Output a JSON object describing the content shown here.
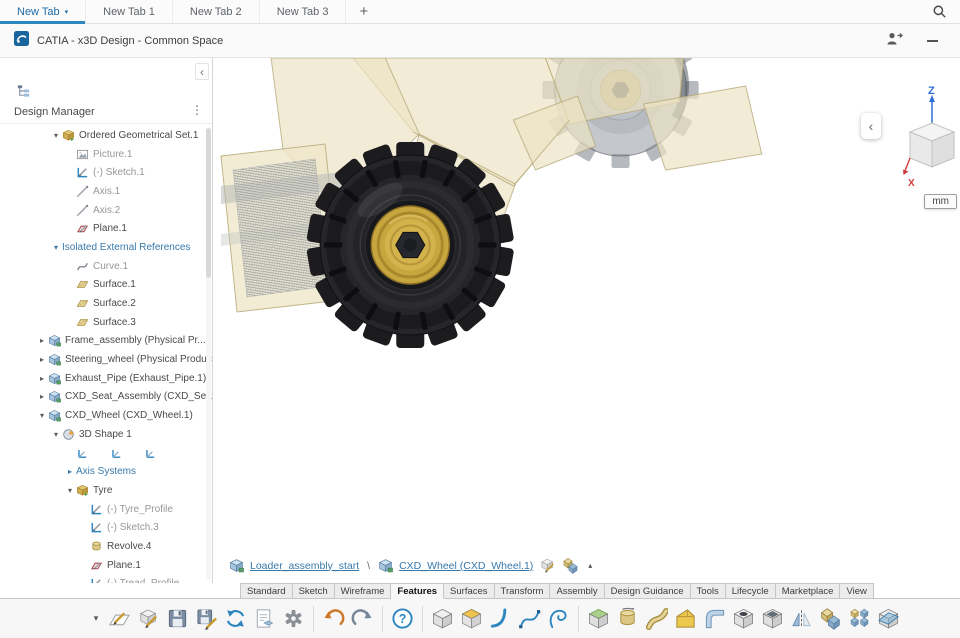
{
  "colors": {
    "accent": "#2e86c1",
    "link": "#3879ab",
    "hub_gold": "#c7a63f"
  },
  "icons": {
    "collapse_chevron": "‹",
    "kebab": "⋮",
    "caret_up": "▴",
    "overflow_chevron": "▾",
    "tab_caret": "▾",
    "expander_open": "▾",
    "expander_closed": "▸",
    "tab_search": "magnifier-icon",
    "share": "share-user-icon",
    "minimize": "minimize-icon"
  },
  "browser_tabs": {
    "items": [
      {
        "label": "New Tab",
        "active": true
      },
      {
        "label": "New Tab 1",
        "active": false
      },
      {
        "label": "New Tab 2",
        "active": false
      },
      {
        "label": "New Tab 3",
        "active": false
      }
    ],
    "new_tab_label": "+"
  },
  "title_bar": {
    "title": "CATIA - x3D Design - Common Space"
  },
  "design_manager": {
    "header": "Design Manager",
    "tree": [
      {
        "label": "Ordered Geometrical Set.1",
        "depth": 1,
        "exp": "open",
        "icon": "geoset"
      },
      {
        "label": "Picture.1",
        "depth": 2,
        "icon": "picture",
        "dim": true
      },
      {
        "label": "(-) Sketch.1",
        "depth": 2,
        "icon": "sketch",
        "dim": true
      },
      {
        "label": "Axis.1",
        "depth": 2,
        "icon": "axis",
        "dim": true
      },
      {
        "label": "Axis.2",
        "depth": 2,
        "icon": "axis",
        "dim": true
      },
      {
        "label": "Plane.1",
        "depth": 2,
        "icon": "plane"
      },
      {
        "label": "Isolated External References",
        "depth": 1,
        "exp": "open",
        "blue": true
      },
      {
        "label": "Curve.1",
        "depth": 2,
        "icon": "curve",
        "dim": true
      },
      {
        "label": "Surface.1",
        "depth": 2,
        "icon": "surface"
      },
      {
        "label": "Surface.2",
        "depth": 2,
        "icon": "surface"
      },
      {
        "label": "Surface.3",
        "depth": 2,
        "icon": "surface"
      },
      {
        "label": "Frame_assembly (Physical Pr...",
        "depth": 0,
        "exp": "closed",
        "icon": "product"
      },
      {
        "label": "Steering_wheel (Physical Product...",
        "depth": 0,
        "exp": "closed",
        "icon": "product"
      },
      {
        "label": "Exhaust_Pipe (Exhaust_Pipe.1)",
        "depth": 0,
        "exp": "closed",
        "icon": "product"
      },
      {
        "label": "CXD_Seat_Assembly (CXD_Seat...",
        "depth": 0,
        "exp": "closed",
        "icon": "product"
      },
      {
        "label": "CXD_Wheel (CXD_Wheel.1)",
        "depth": 0,
        "exp": "open",
        "icon": "product"
      },
      {
        "label": "3D Shape 1",
        "depth": 1,
        "exp": "open",
        "icon": "shape3d"
      },
      {
        "icons": [
          "axsys",
          "axsys",
          "axsys"
        ],
        "depth": 2
      },
      {
        "label": "Axis Systems",
        "depth": 2,
        "exp": "closed",
        "blue": true
      },
      {
        "label": "Tyre",
        "depth": 2,
        "exp": "open",
        "icon": "geoset"
      },
      {
        "label": "(-) Tyre_Profile",
        "depth": 3,
        "icon": "sketch",
        "dim": true
      },
      {
        "label": "(-) Sketch.3",
        "depth": 3,
        "icon": "sketch",
        "dim": true
      },
      {
        "label": "Revolve.4",
        "depth": 3,
        "icon": "revolve"
      },
      {
        "label": "Plane.1",
        "depth": 3,
        "icon": "plane"
      },
      {
        "label": "(-) Tread_Profile",
        "depth": 3,
        "icon": "sketch",
        "dim": true
      }
    ]
  },
  "viewport": {
    "unit": "mm",
    "axes": {
      "z": "Z",
      "x": "X"
    },
    "breadcrumb": {
      "root": "Loader_assembly_start",
      "separator": "\\",
      "current": "CXD_Wheel (CXD_Wheel.1)"
    }
  },
  "ribbon": {
    "tabs": [
      "Standard",
      "Sketch",
      "Wireframe",
      "Features",
      "Surfaces",
      "Transform",
      "Assembly",
      "Design Guidance",
      "Tools",
      "Lifecycle",
      "Marketplace",
      "View"
    ],
    "active": "Features"
  },
  "toolbar": {
    "items": [
      "sketch",
      "positioned-sketch",
      "save",
      "save-with-options",
      "update",
      "drawing",
      "settings",
      "|",
      "undo",
      "redo",
      "|",
      "help",
      "|",
      "box",
      "pad",
      "shaft",
      "spline",
      "helix",
      "|",
      "extrude",
      "revolve",
      "sweep",
      "chamfer",
      "fillet",
      "hole",
      "shell",
      "mirror",
      "boolean",
      "pattern",
      "split"
    ]
  }
}
